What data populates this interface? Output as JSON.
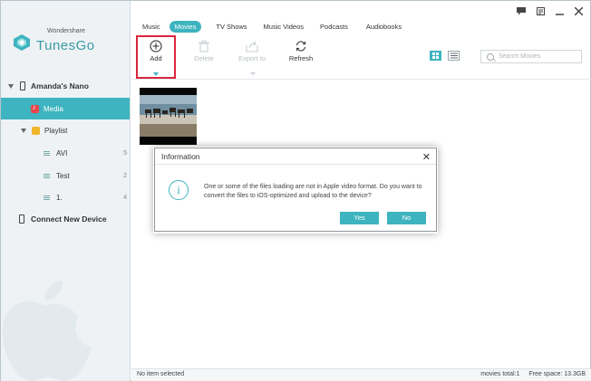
{
  "app": {
    "brand_small": "Wondershare",
    "brand_name": "TunesGo"
  },
  "sidebar": {
    "device_name": "Amanda's Nano",
    "media_label": "Media",
    "playlist_label": "Playlist",
    "playlists": [
      {
        "label": "AVI",
        "count": "5"
      },
      {
        "label": "Test",
        "count": "2"
      },
      {
        "label": "1.",
        "count": "4"
      }
    ],
    "connect_label": "Connect New Device"
  },
  "tabs": [
    "Music",
    "Movies",
    "TV Shows",
    "Music Videos",
    "Podcasts",
    "Audiobooks"
  ],
  "active_tab": "Movies",
  "toolbar": {
    "add_label": "Add",
    "delete_label": "Delete",
    "export_label": "Export to",
    "refresh_label": "Refresh",
    "search_placeholder": "Search Movies"
  },
  "dialog": {
    "title": "Information",
    "message": "One or some of the files loading are not in Apple video format. Do you want to convert the files to iOS-optimized and upload to the device?",
    "yes_label": "Yes",
    "no_label": "No"
  },
  "status": {
    "left": "No item selected",
    "total": "movies total:1",
    "free_space": "Free space: 13.3GB"
  },
  "colors": {
    "accent": "#3db4bf",
    "highlight_border": "#d9263d",
    "media_icon": "#e8464c",
    "playlist_icon": "#f2b62c"
  }
}
